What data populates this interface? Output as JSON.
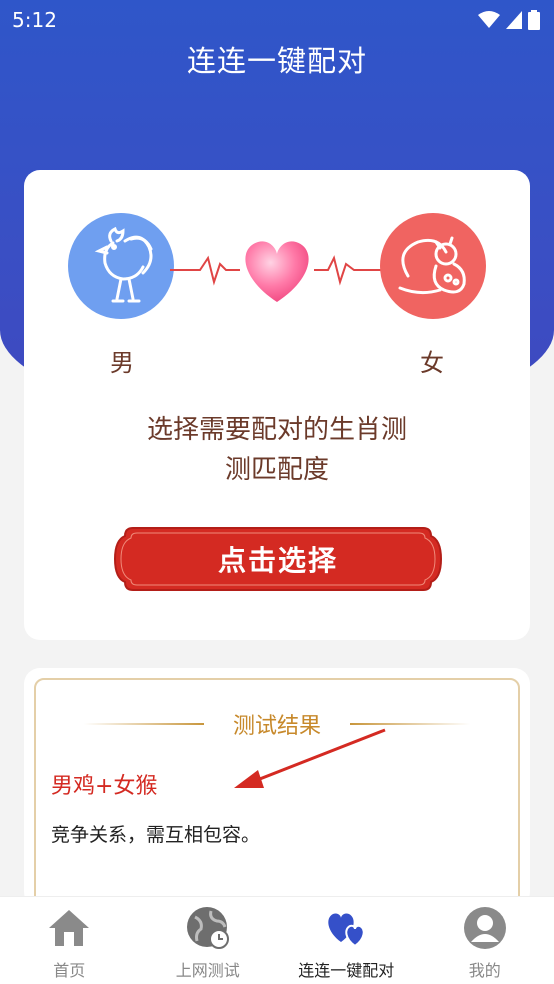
{
  "status_bar": {
    "time": "5:12"
  },
  "app_title": "连连一键配对",
  "pair_card": {
    "male_label": "男",
    "female_label": "女",
    "prompt_line1": "选择需要配对的生肖测",
    "prompt_line2": "测匹配度",
    "select_button": "点击选择"
  },
  "result": {
    "heading": "测试结果",
    "pair": "男鸡+女猴",
    "description": "竞争关系，需互相包容。"
  },
  "tabs": [
    {
      "label": "首页",
      "icon": "home-icon"
    },
    {
      "label": "上网测试",
      "icon": "globe-clock-icon"
    },
    {
      "label": "连连一键配对",
      "icon": "hearts-icon",
      "active": true
    },
    {
      "label": "我的",
      "icon": "user-icon"
    }
  ],
  "colors": {
    "header_blue": "#3a4fc4",
    "male_bg": "#6f9ff0",
    "female_bg": "#f06461",
    "button_red": "#d42a22",
    "result_red": "#d42a22",
    "gold": "#c7892b"
  }
}
